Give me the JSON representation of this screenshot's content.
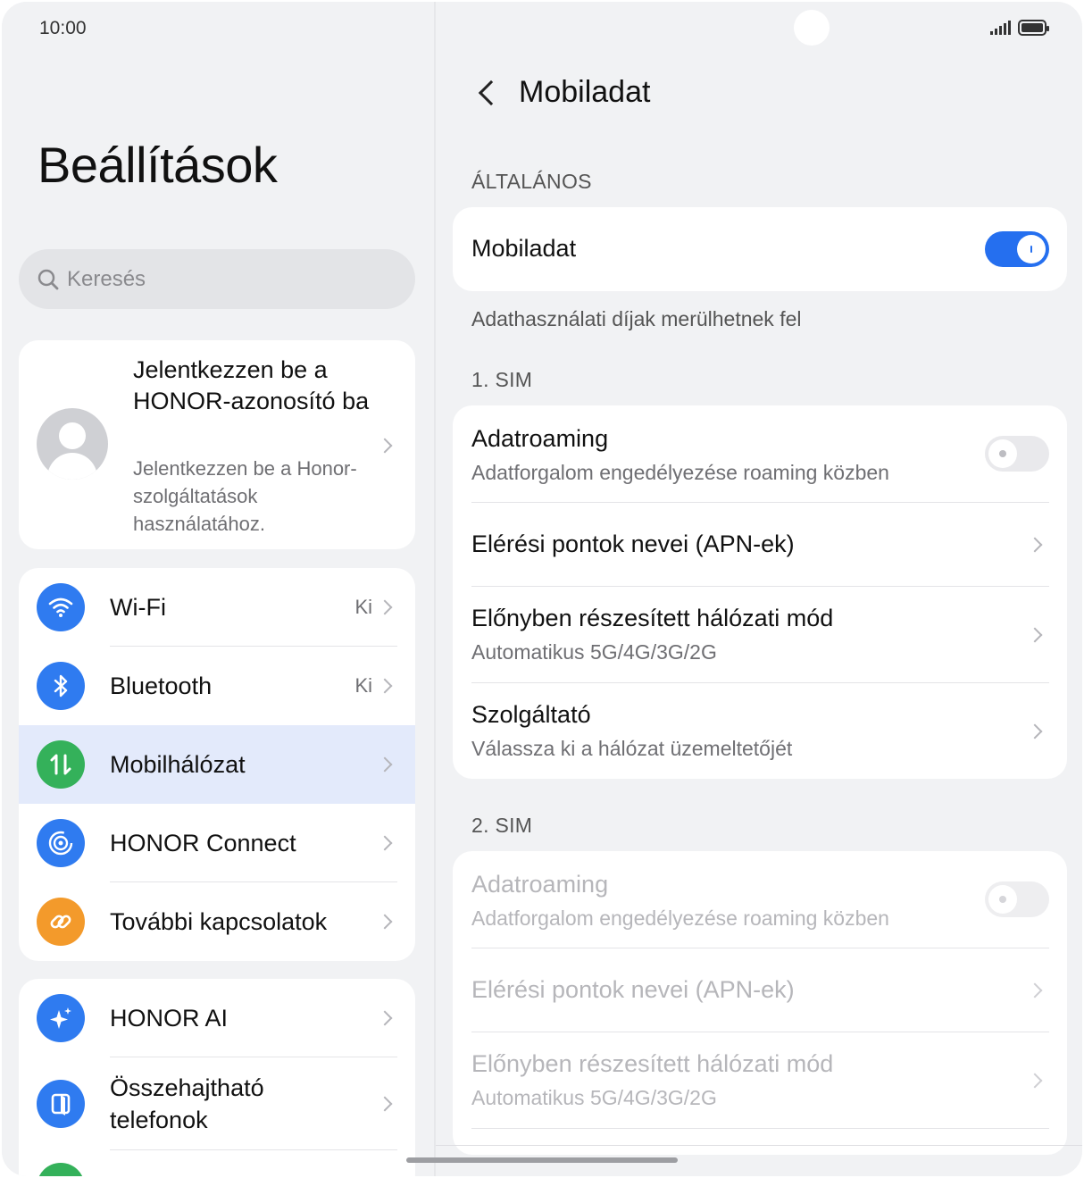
{
  "status_bar": {
    "time": "10:00"
  },
  "left": {
    "title": "Beállítások",
    "search": {
      "placeholder": "Keresés"
    },
    "account": {
      "title": "Jelentkezzen be a HONOR-azonosító ba",
      "subtitle": "Jelentkezzen be a Honor-szolgáltatások használatához."
    },
    "group1": [
      {
        "label": "Wi-Fi",
        "value": "Ki",
        "icon": "wifi-icon",
        "color": "#2f7bf0"
      },
      {
        "label": "Bluetooth",
        "value": "Ki",
        "icon": "bluetooth-icon",
        "color": "#2f7bf0"
      },
      {
        "label": "Mobilhálózat",
        "value": "",
        "icon": "mobile-data-icon",
        "color": "#34b15a",
        "selected": true
      },
      {
        "label": "HONOR Connect",
        "value": "",
        "icon": "honor-connect-icon",
        "color": "#2f7bf0"
      },
      {
        "label": "További kapcsolatok",
        "value": "",
        "icon": "link-icon",
        "color": "#f39a2b"
      }
    ],
    "group2": [
      {
        "label": "HONOR AI",
        "icon": "ai-sparkle-icon",
        "color": "#2f7bf0"
      },
      {
        "label": "Összehajtható telefonok",
        "icon": "foldable-icon",
        "color": "#2f7bf0"
      }
    ]
  },
  "right": {
    "title": "Mobiladat",
    "section_general": "ÁLTALÁNOS",
    "mobile_data": {
      "label": "Mobiladat",
      "enabled": true
    },
    "note": "Adathasználati díjak merülhetnek fel",
    "sim1": {
      "header": "1. SIM",
      "roaming_title": "Adatroaming",
      "roaming_sub": "Adatforgalom engedélyezése roaming közben",
      "apn": "Elérési pontok nevei (APN-ek)",
      "pref_title": "Előnyben részesített hálózati mód",
      "pref_sub": "Automatikus 5G/4G/3G/2G",
      "provider_title": "Szolgáltató",
      "provider_sub": "Válassza ki a hálózat üzemeltetőjét"
    },
    "sim2": {
      "header": "2. SIM",
      "roaming_title": "Adatroaming",
      "roaming_sub": "Adatforgalom engedélyezése roaming közben",
      "apn": "Elérési pontok nevei (APN-ek)",
      "pref_title": "Előnyben részesített hálózati mód",
      "pref_sub": "Automatikus 5G/4G/3G/2G"
    }
  }
}
